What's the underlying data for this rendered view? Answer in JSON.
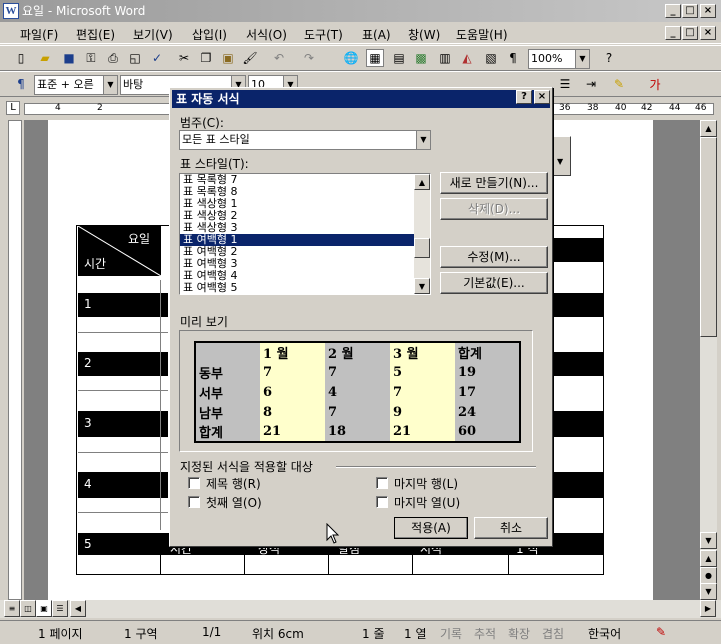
{
  "window": {
    "title": "요일 - Microsoft Word",
    "app_icon": "W"
  },
  "menu": [
    "파일(F)",
    "편집(E)",
    "보기(V)",
    "삽입(I)",
    "서식(O)",
    "도구(T)",
    "표(A)",
    "창(W)",
    "도움말(H)"
  ],
  "toolbar": {
    "zoom": "100%"
  },
  "format_bar": {
    "style": "표준 + 오른",
    "font": "바탕",
    "size": "10"
  },
  "ruler": {
    "ticks_left": [
      "4",
      "2"
    ],
    "ticks_right": [
      "36",
      "38",
      "40",
      "42",
      "44",
      "46"
    ]
  },
  "document": {
    "header_day": "요일",
    "header_time": "시간",
    "rows": [
      "1",
      "2",
      "3",
      "4",
      "5"
    ],
    "bottom_row": [
      "시간",
      "장석",
      "달짐",
      "시석",
      "1 석"
    ]
  },
  "dialog": {
    "title": "표 자동 서식",
    "category_label": "범주(C):",
    "category_value": "모든 표 스타일",
    "styles_label": "표 스타일(T):",
    "style_items": [
      "표 목록형 7",
      "표 목록형 8",
      "표 색상형 1",
      "표 색상형 2",
      "표 색상형 3",
      "표 여백형 1",
      "표 여백형 2",
      "표 여백형 3",
      "표 여백형 4",
      "표 여백형 5"
    ],
    "selected_index": 5,
    "buttons": {
      "new": "새로 만들기(N)...",
      "delete": "삭제(D)...",
      "modify": "수정(M)...",
      "default": "기본값(E)...",
      "apply": "적용(A)",
      "cancel": "취소"
    },
    "preview_label": "미리 보기",
    "preview": {
      "header": [
        "",
        "1 월",
        "2 월",
        "3 월",
        "합계"
      ],
      "rows": [
        [
          "동부",
          "7",
          "7",
          "5",
          "19"
        ],
        [
          "서부",
          "6",
          "4",
          "7",
          "17"
        ],
        [
          "남부",
          "8",
          "7",
          "9",
          "24"
        ],
        [
          "합계",
          "21",
          "18",
          "21",
          "60"
        ]
      ]
    },
    "apply_to_label": "지정된 서식을 적용할 대상",
    "options": {
      "header_rows": "제목 행(R)",
      "first_column": "첫째 열(O)",
      "last_row": "마지막 행(L)",
      "last_column": "마지막 열(U)"
    }
  },
  "status": {
    "page": "1 페이지",
    "section": "1 구역",
    "pages": "1/1",
    "position": "위치 6cm",
    "line": "1 줄",
    "column": "1 열",
    "rec": "기록",
    "trk": "추적",
    "ext": "확장",
    "ovr": "겹침",
    "language": "한국어"
  }
}
